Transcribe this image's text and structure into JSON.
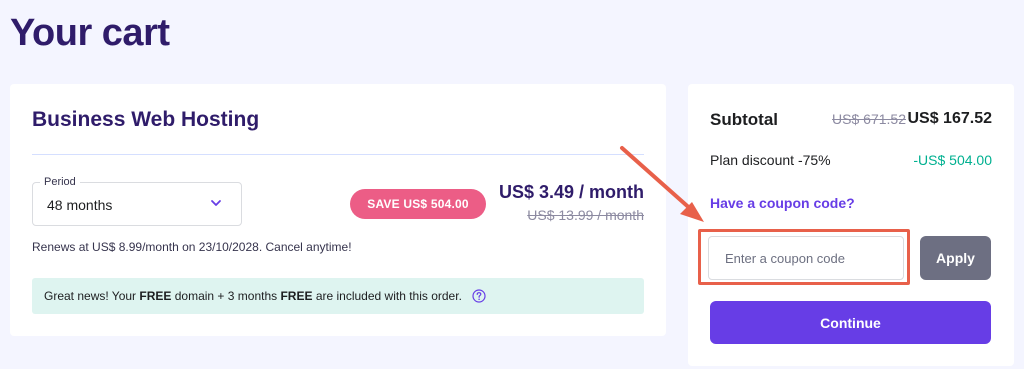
{
  "page": {
    "title": "Your cart"
  },
  "product": {
    "name": "Business Web Hosting",
    "period": {
      "label": "Period",
      "value": "48 months"
    },
    "save_badge": "SAVE US$ 504.00",
    "price_current": "US$ 3.49 / month",
    "price_old": "US$ 13.99 / month",
    "renews_text": "Renews at US$ 8.99/month on 23/10/2028. Cancel anytime!",
    "banner": {
      "part1": "Great news! Your ",
      "free1": "FREE",
      "part2": " domain + 3 months ",
      "free2": "FREE",
      "part3": " are included with this order."
    }
  },
  "summary": {
    "subtotal_label": "Subtotal",
    "subtotal_old": "US$ 671.52",
    "subtotal_new": "US$ 167.52",
    "discount_label": "Plan discount -75%",
    "discount_value": "-US$ 504.00",
    "coupon_link": "Have a coupon code?",
    "coupon_placeholder": "Enter a coupon code",
    "apply_label": "Apply",
    "continue_label": "Continue"
  },
  "colors": {
    "brand_primary": "#673de6",
    "title": "#2f1c6a",
    "save_badge": "#ec5d86",
    "discount_green": "#00b090",
    "annotation": "#e8604a",
    "banner_bg": "#def4f0"
  },
  "icons": {
    "period_chevron": "chevron-down-icon",
    "banner_help": "help-circle-icon",
    "annotation": "arrow-annotation"
  }
}
